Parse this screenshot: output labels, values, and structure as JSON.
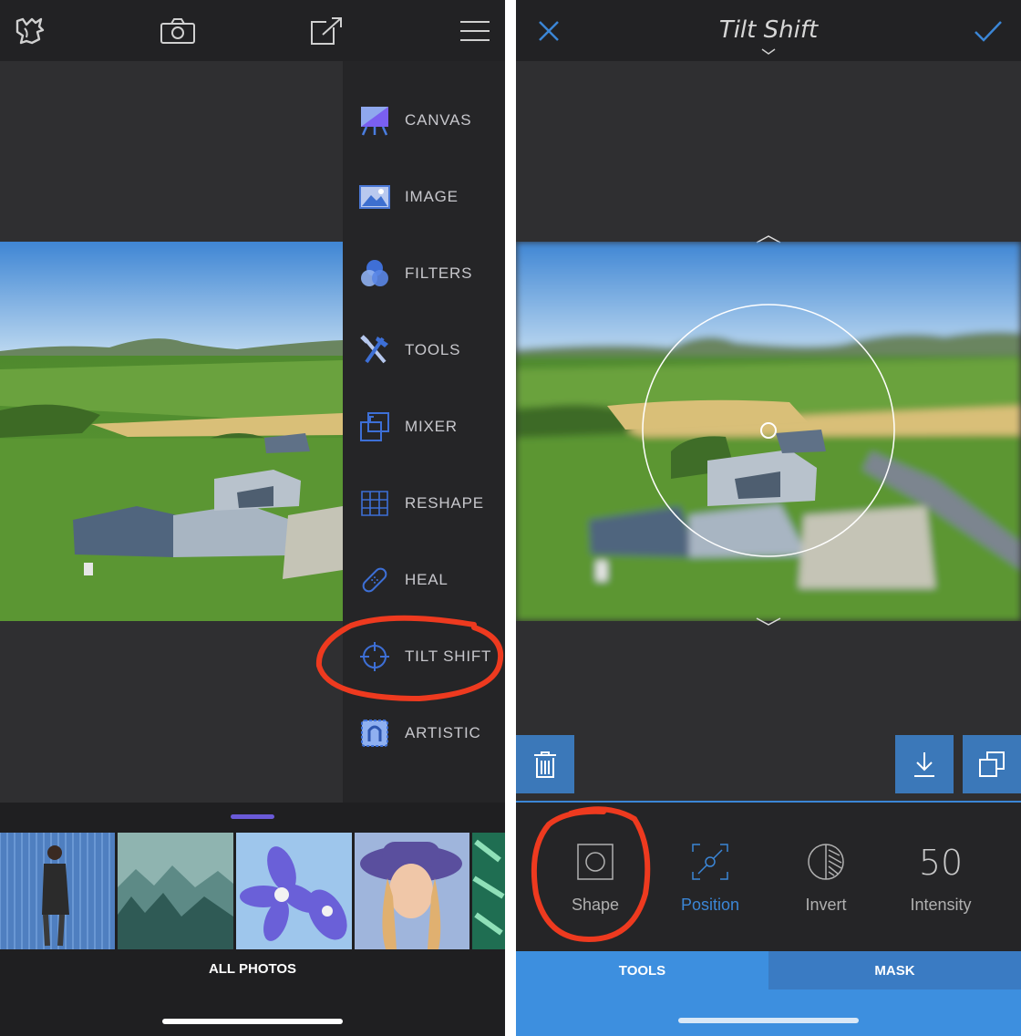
{
  "left": {
    "toolbar": {
      "logo_icon": "bird-logo-icon",
      "camera_icon": "camera-icon",
      "share_icon": "share-icon",
      "menu_icon": "hamburger-menu-icon"
    },
    "menu": [
      {
        "label": "CANVAS",
        "icon": "canvas-icon"
      },
      {
        "label": "IMAGE",
        "icon": "image-icon"
      },
      {
        "label": "FILTERS",
        "icon": "filters-icon"
      },
      {
        "label": "TOOLS",
        "icon": "tools-icon"
      },
      {
        "label": "MIXER",
        "icon": "mixer-icon"
      },
      {
        "label": "RESHAPE",
        "icon": "reshape-icon"
      },
      {
        "label": "HEAL",
        "icon": "heal-icon"
      },
      {
        "label": "TILT SHIFT",
        "icon": "crosshair-icon"
      },
      {
        "label": "ARTISTIC",
        "icon": "artistic-icon"
      }
    ],
    "gallery": {
      "label": "ALL PHOTOS"
    }
  },
  "right": {
    "header": {
      "title": "Tilt Shift",
      "close_icon": "close-icon",
      "confirm_icon": "checkmark-icon"
    },
    "options": [
      {
        "label": "Shape",
        "selected": false
      },
      {
        "label": "Position",
        "selected": true
      },
      {
        "label": "Invert",
        "selected": false
      },
      {
        "label": "Intensity",
        "value": "50"
      }
    ],
    "tabs": {
      "tools": "TOOLS",
      "mask": "MASK"
    }
  },
  "colors": {
    "accent_blue": "#3b86d6",
    "annotation_red": "#ee3a1f",
    "handle_purple": "#6a5ad8"
  }
}
